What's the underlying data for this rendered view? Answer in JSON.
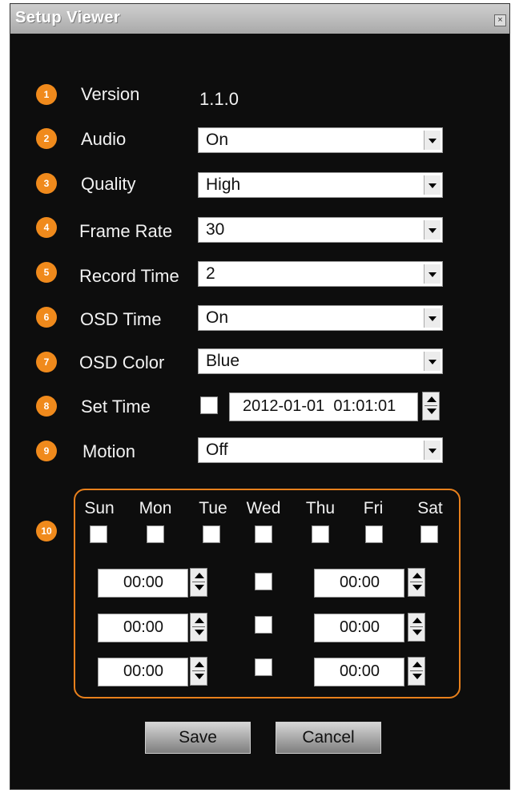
{
  "window": {
    "title": "Setup Viewer",
    "close_glyph": "×"
  },
  "settings": {
    "version": {
      "badge": "1",
      "label": "Version",
      "value": "1.1.0"
    },
    "audio": {
      "badge": "2",
      "label": "Audio",
      "value": "On"
    },
    "quality": {
      "badge": "3",
      "label": "Quality",
      "value": "High"
    },
    "frame_rate": {
      "badge": "4",
      "label": "Frame Rate",
      "value": "30"
    },
    "record_time": {
      "badge": "5",
      "label": "Record Time",
      "value": "2"
    },
    "osd_time": {
      "badge": "6",
      "label": "OSD Time",
      "value": "On"
    },
    "osd_color": {
      "badge": "7",
      "label": "OSD Color",
      "value": "Blue"
    },
    "set_time": {
      "badge": "8",
      "label": "Set Time",
      "value": "2012-01-01  01:01:01"
    },
    "motion": {
      "badge": "9",
      "label": "Motion",
      "value": "Off"
    }
  },
  "schedule": {
    "badge": "10",
    "days": [
      "Sun",
      "Mon",
      "Tue",
      "Wed",
      "Thu",
      "Fri",
      "Sat"
    ],
    "rows": [
      {
        "start": "00:00",
        "end": "00:00"
      },
      {
        "start": "00:00",
        "end": "00:00"
      },
      {
        "start": "00:00",
        "end": "00:00"
      }
    ]
  },
  "buttons": {
    "save": "Save",
    "cancel": "Cancel"
  },
  "colors": {
    "accent": "#f08a1c",
    "background": "#0d0d0d"
  }
}
